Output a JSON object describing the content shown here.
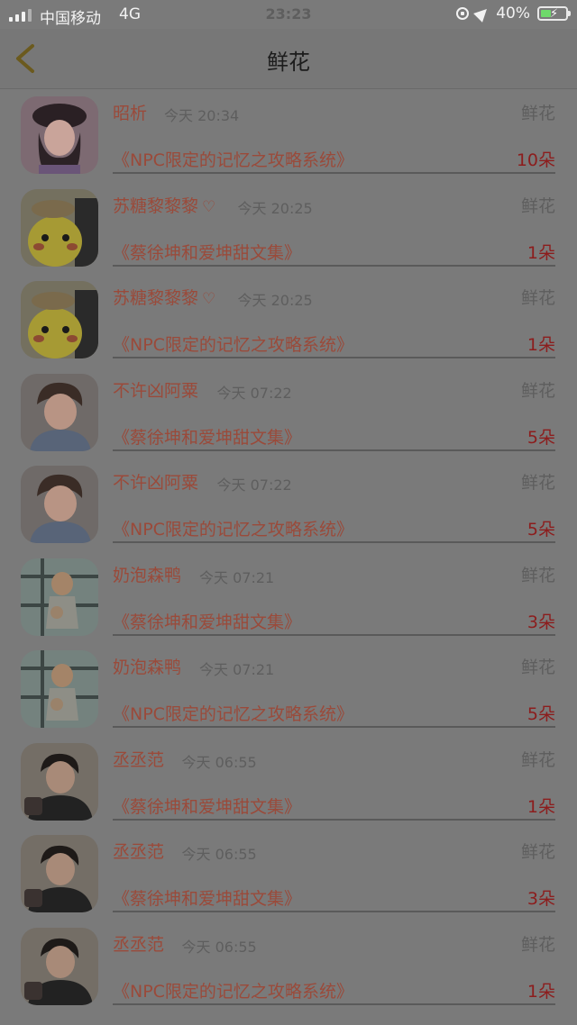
{
  "status_bar": {
    "carrier": "中国移动",
    "network": "4G",
    "time": "23:23",
    "battery": "40%"
  },
  "nav": {
    "title": "鲜花",
    "back_icon": "chevron-left-icon"
  },
  "gift_label": "鲜花",
  "rows": [
    {
      "name": "昭析",
      "heart": false,
      "time": "今天 20:34",
      "book": "《NPC限定的记忆之攻略系统》",
      "count": "10朵",
      "avatar": "girl-beret"
    },
    {
      "name": "苏糖黎黎黎",
      "heart": true,
      "time": "今天 20:25",
      "book": "《蔡徐坤和爱坤甜文集》",
      "count": "1朵",
      "avatar": "pikachu"
    },
    {
      "name": "苏糖黎黎黎",
      "heart": true,
      "time": "今天 20:25",
      "book": "《NPC限定的记忆之攻略系统》",
      "count": "1朵",
      "avatar": "pikachu"
    },
    {
      "name": "不许凶阿粟",
      "heart": false,
      "time": "今天 07:22",
      "book": "《蔡徐坤和爱坤甜文集》",
      "count": "5朵",
      "avatar": "boy-denim"
    },
    {
      "name": "不许凶阿粟",
      "heart": false,
      "time": "今天 07:22",
      "book": "《NPC限定的记忆之攻略系统》",
      "count": "5朵",
      "avatar": "boy-denim"
    },
    {
      "name": "奶泡森鸭",
      "heart": false,
      "time": "今天 07:21",
      "book": "《蔡徐坤和爱坤甜文集》",
      "count": "3朵",
      "avatar": "cartoon-girl"
    },
    {
      "name": "奶泡森鸭",
      "heart": false,
      "time": "今天 07:21",
      "book": "《NPC限定的记忆之攻略系统》",
      "count": "5朵",
      "avatar": "cartoon-girl"
    },
    {
      "name": "丞丞范",
      "heart": false,
      "time": "今天 06:55",
      "book": "《蔡徐坤和爱坤甜文集》",
      "count": "1朵",
      "avatar": "boy-black"
    },
    {
      "name": "丞丞范",
      "heart": false,
      "time": "今天 06:55",
      "book": "《蔡徐坤和爱坤甜文集》",
      "count": "3朵",
      "avatar": "boy-black"
    },
    {
      "name": "丞丞范",
      "heart": false,
      "time": "今天 06:55",
      "book": "《NPC限定的记忆之攻略系统》",
      "count": "1朵",
      "avatar": "boy-black"
    }
  ]
}
